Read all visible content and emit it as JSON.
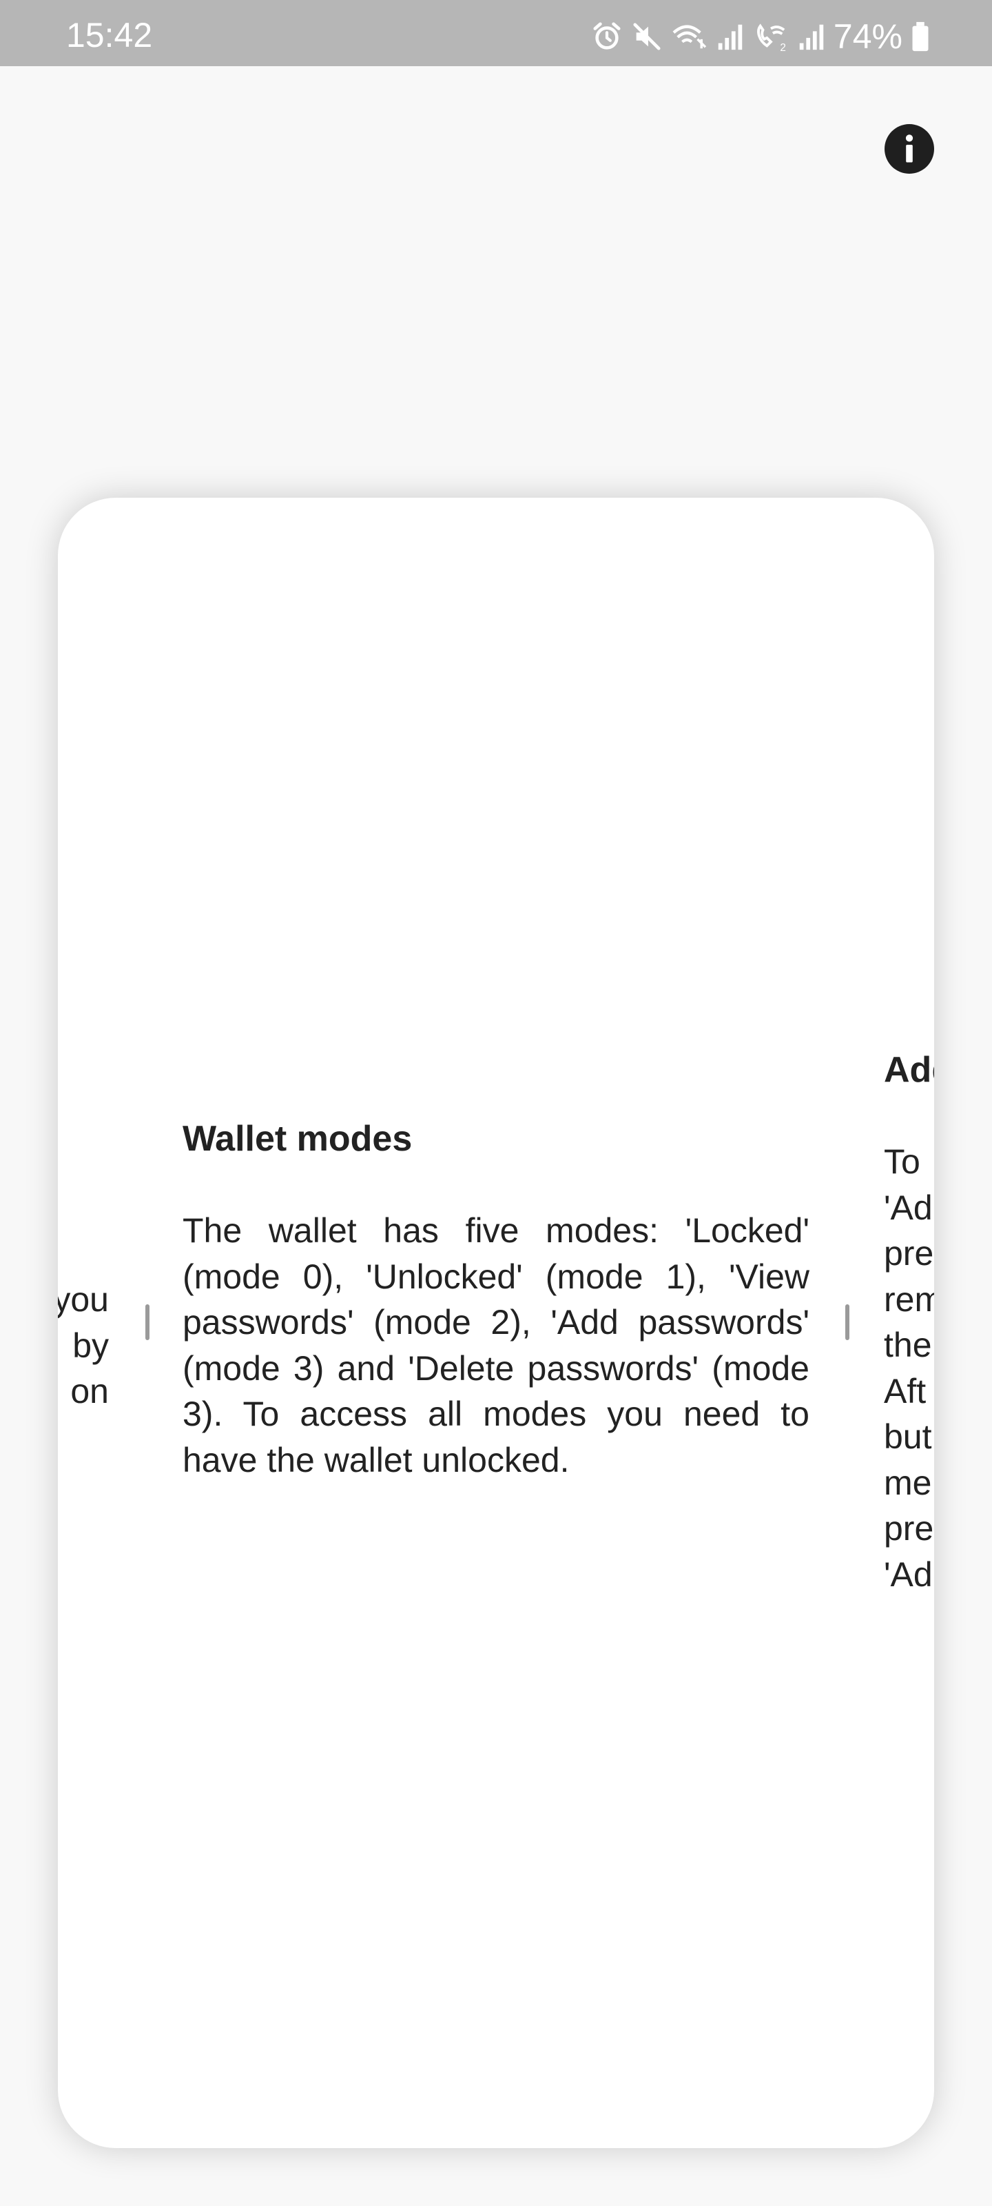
{
  "status_bar": {
    "time": "15:42",
    "battery": "74%",
    "icons": [
      "alarm-icon",
      "mute-icon",
      "wifi-calling-icon",
      "signal-icon",
      "wifi-calling-2-icon",
      "signal-2-icon",
      "battery-icon"
    ]
  },
  "info_button": {
    "icon": "info-icon"
  },
  "pages": {
    "left": {
      "body": "you\nby\non"
    },
    "center": {
      "title": "Wallet modes",
      "body": "The wallet has five modes: 'Locked' (mode 0), 'Unlocked' (mode 1), 'View passwords' (mode 2), 'Add passwords' (mode 3) and 'Delete passwords' (mode 3). To access all modes you need to have the wallet unlocked."
    },
    "right": {
      "title": "Add",
      "body": "To\n'Ad\npre\nrem\nthe\nAft\nbut\nme\npre\n'Ad"
    }
  },
  "colors": {
    "status_bar_bg": "#b6b6b6",
    "page_bg": "#f8f8f8",
    "card_bg": "#ffffff",
    "text": "#222222",
    "divider": "#9a9a9a"
  }
}
